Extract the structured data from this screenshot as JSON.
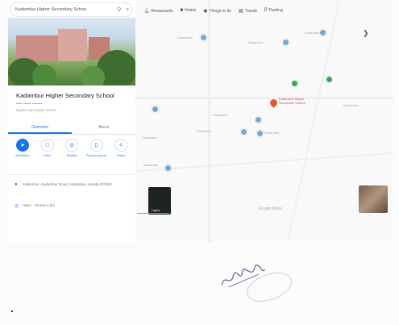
{
  "search": {
    "query": "Kadambur Higher Secondary Schoo"
  },
  "place": {
    "name": "Kadambur Higher Secondary School",
    "rating_line": "••••• •••••• ••••••••",
    "category": "Higher secondary school"
  },
  "tabs": [
    {
      "label": "Overview"
    },
    {
      "label": "About"
    }
  ],
  "actions": [
    {
      "label": "Directions",
      "icon": "directions-icon"
    },
    {
      "label": "Save",
      "icon": "save-icon"
    },
    {
      "label": "Nearby",
      "icon": "nearby-icon"
    },
    {
      "label": "Send to phone",
      "icon": "phone-icon"
    },
    {
      "label": "Share",
      "icon": "share-icon"
    }
  ],
  "info": {
    "address": "Kadambur, Kadambur Road, Kadambur, Kerala 670502",
    "hours": "Open · Closes 4 pm"
  },
  "map": {
    "chips": [
      {
        "label": "Restaurants",
        "icon": "restaurant-icon"
      },
      {
        "label": "Hotels",
        "icon": "hotel-icon"
      },
      {
        "label": "Things to do",
        "icon": "camera-icon"
      },
      {
        "label": "Transit",
        "icon": "transit-icon"
      },
      {
        "label": "Parking",
        "icon": "parking-icon"
      }
    ],
    "marker_label": "Kadambur Higher Secondary School",
    "labels": [
      "Kadambur",
      "Kadambur",
      "Kadambur",
      "Kadambur",
      "Kadambur",
      "Kadambur",
      "Kadambur",
      "Kadambur",
      "Kadambur"
    ],
    "google": "Google Maps",
    "thumb_left": "Layers"
  },
  "colors": {
    "accent": "#1a73e8",
    "marker": "#e4572e",
    "green": "#34a853"
  }
}
